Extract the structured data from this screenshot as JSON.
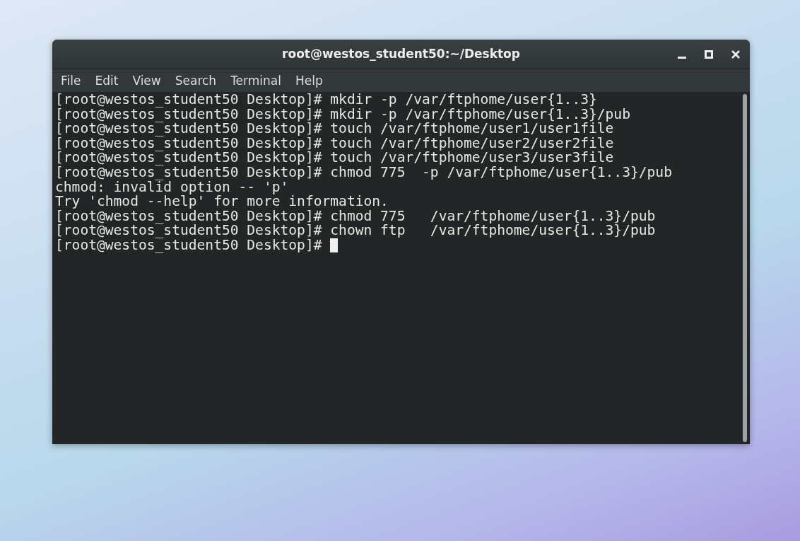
{
  "window": {
    "title": "root@westos_student50:~/Desktop"
  },
  "menu": [
    "File",
    "Edit",
    "View",
    "Search",
    "Terminal",
    "Help"
  ],
  "terminal": {
    "lines": [
      {
        "text": "[root@westos_student50 Desktop]# mkdir -p /var/ftphome/user{1..3}",
        "cursor": false
      },
      {
        "text": "[root@westos_student50 Desktop]# mkdir -p /var/ftphome/user{1..3}/pub",
        "cursor": false
      },
      {
        "text": "[root@westos_student50 Desktop]# touch /var/ftphome/user1/user1file",
        "cursor": false
      },
      {
        "text": "[root@westos_student50 Desktop]# touch /var/ftphome/user2/user2file",
        "cursor": false
      },
      {
        "text": "[root@westos_student50 Desktop]# touch /var/ftphome/user3/user3file",
        "cursor": false
      },
      {
        "text": "[root@westos_student50 Desktop]# chmod 775  -p /var/ftphome/user{1..3}/pub",
        "cursor": false
      },
      {
        "text": "chmod: invalid option -- 'p'",
        "cursor": false
      },
      {
        "text": "Try 'chmod --help' for more information.",
        "cursor": false
      },
      {
        "text": "[root@westos_student50 Desktop]# chmod 775   /var/ftphome/user{1..3}/pub",
        "cursor": false
      },
      {
        "text": "[root@westos_student50 Desktop]# chown ftp   /var/ftphome/user{1..3}/pub",
        "cursor": false
      },
      {
        "text": "[root@westos_student50 Desktop]# ",
        "cursor": true
      }
    ]
  }
}
